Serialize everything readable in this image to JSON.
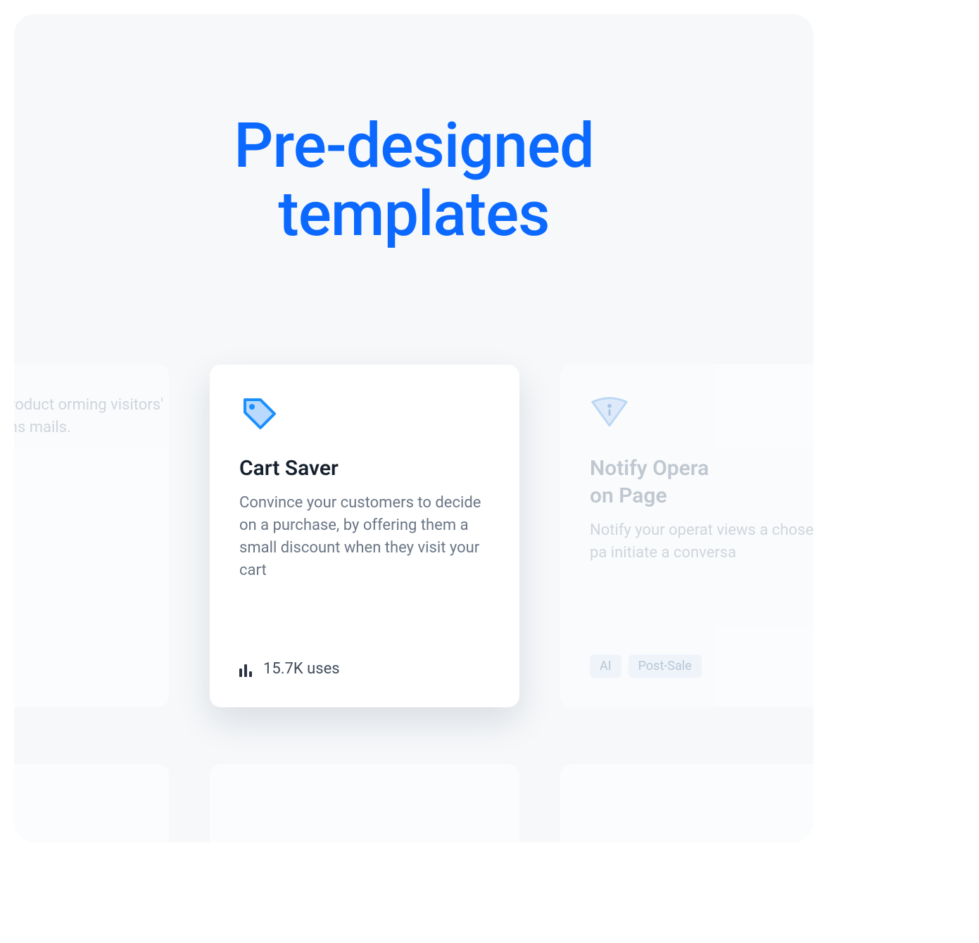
{
  "heading": {
    "line1": "Pre-designed",
    "line2": "templates"
  },
  "cards": {
    "left": {
      "desc_fragment": " about product orming visitors' questions mails."
    },
    "center": {
      "title": "Cart Saver",
      "desc": "Convince your customers to decide on a purchase, by offering them a small discount when they visit your cart",
      "uses": "15.7K uses"
    },
    "right": {
      "title_line1": "Notify Opera",
      "title_line2": "on Page",
      "desc": "Notify your operat views a chosen pa initiate a conversa",
      "tag1": "AI",
      "tag2": "Post-Sale"
    }
  }
}
